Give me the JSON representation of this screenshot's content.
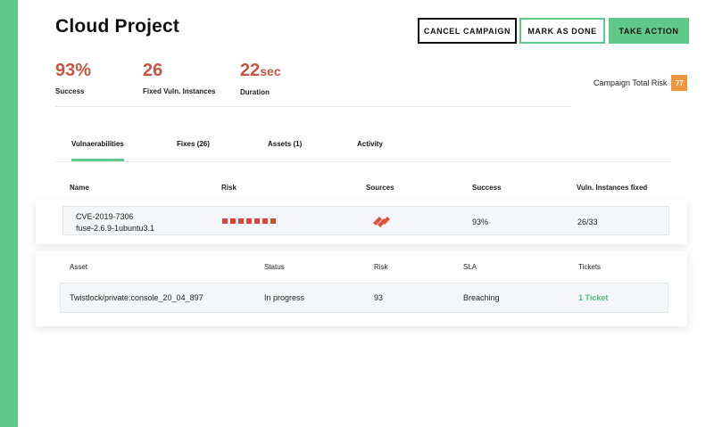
{
  "page": {
    "title": "Cloud Project"
  },
  "actions": {
    "cancel": "CANCEL CAMPAIGN",
    "mark_done": "MARK AS DONE",
    "take_action": "TAKE ACTION"
  },
  "stats": [
    {
      "value": "93%",
      "unit": "",
      "label": "Success"
    },
    {
      "value": "26",
      "unit": "",
      "label": "Fixed Vuln. Instances"
    },
    {
      "value": "22",
      "unit": "sec",
      "label": "Duration"
    }
  ],
  "campaign_risk": {
    "label": "Campaign Total Risk",
    "value": "77",
    "badge_color": "#f0953c"
  },
  "tabs": [
    {
      "label": "Vulnaerabilities",
      "active": true
    },
    {
      "label": "Fixes (26)",
      "active": false
    },
    {
      "label": "Assets (1)",
      "active": false
    },
    {
      "label": "Activity",
      "active": false
    }
  ],
  "vuln_table": {
    "headers": [
      "Name",
      "Risk",
      "Sources",
      "Success",
      "Vuln. Instances fixed"
    ],
    "rows": [
      {
        "name_line1": "CVE-2019-7306",
        "name_line2": "fuse-2.6.9-1ubuntu3.1",
        "risk_level": 7,
        "source_icon": "paloalto-logo-icon",
        "success": "93%",
        "instances_fixed": "26/33"
      }
    ]
  },
  "asset_table": {
    "headers": [
      "Asset",
      "Status",
      "Risk",
      "SLA",
      "Tickets"
    ],
    "rows": [
      {
        "asset": "Twistlock/private:console_20_04_897",
        "status": "In progress",
        "risk": "93",
        "sla": "Breaching",
        "tickets": "1 Ticket"
      }
    ]
  },
  "colors": {
    "accent": "#5fc98a",
    "stat_value": "#c85544",
    "risk_square": "#d8453a",
    "ticket_link": "#4ec27d"
  }
}
